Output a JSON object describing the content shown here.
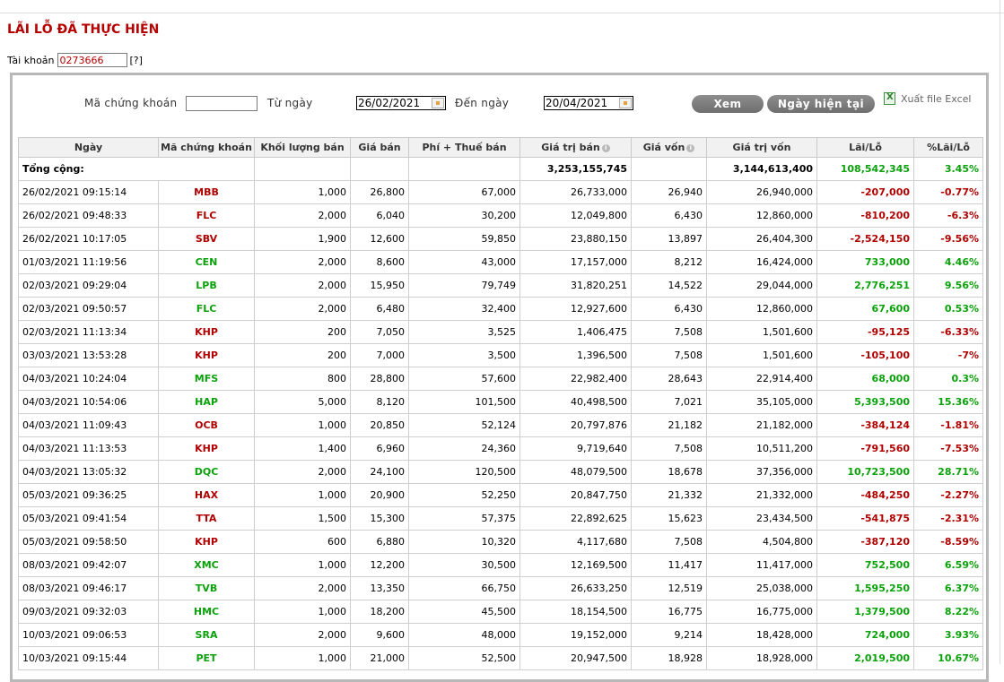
{
  "page": {
    "title": "LÃI LỖ ĐÃ THỰC HIỆN",
    "account_label": "Tài khoản",
    "account_value": "0273666",
    "help": "[?]"
  },
  "filters": {
    "symbol_label": "Mã chứng khoán",
    "symbol_value": "",
    "from_label": "Từ ngày",
    "from_value": "26/02/2021",
    "to_label": "Đến ngày",
    "to_value": "20/04/2021",
    "view_button": "Xem",
    "today_button": "Ngày hiện tại",
    "export_label": "Xuất file Excel"
  },
  "table": {
    "headers": [
      "Ngày",
      "Mã chứng khoán",
      "Khối lượng bán",
      "Giá bán",
      "Phí + Thuế bán",
      "Giá trị bán",
      "Giá vốn",
      "Giá trị vốn",
      "Lãi/Lỗ",
      "%Lãi/Lỗ"
    ],
    "total": {
      "label": "Tổng cộng:",
      "sell_value": "3,253,155,745",
      "cost_value": "3,144,613,400",
      "pl": "108,542,345",
      "pl_pct": "3.45%"
    },
    "rows": [
      {
        "date": "26/02/2021 09:15:14",
        "symbol": "MBB",
        "qty": "1,000",
        "price": "26,800",
        "fee": "67,000",
        "sell_value": "26,733,000",
        "cost": "26,940",
        "cost_value": "26,940,000",
        "pl": "-207,000",
        "pct": "-0.77%"
      },
      {
        "date": "26/02/2021 09:48:33",
        "symbol": "FLC",
        "qty": "2,000",
        "price": "6,040",
        "fee": "30,200",
        "sell_value": "12,049,800",
        "cost": "6,430",
        "cost_value": "12,860,000",
        "pl": "-810,200",
        "pct": "-6.3%"
      },
      {
        "date": "26/02/2021 10:17:05",
        "symbol": "SBV",
        "qty": "1,900",
        "price": "12,600",
        "fee": "59,850",
        "sell_value": "23,880,150",
        "cost": "13,897",
        "cost_value": "26,404,300",
        "pl": "-2,524,150",
        "pct": "-9.56%"
      },
      {
        "date": "01/03/2021 11:19:56",
        "symbol": "CEN",
        "qty": "2,000",
        "price": "8,600",
        "fee": "43,000",
        "sell_value": "17,157,000",
        "cost": "8,212",
        "cost_value": "16,424,000",
        "pl": "733,000",
        "pct": "4.46%"
      },
      {
        "date": "02/03/2021 09:29:04",
        "symbol": "LPB",
        "qty": "2,000",
        "price": "15,950",
        "fee": "79,749",
        "sell_value": "31,820,251",
        "cost": "14,522",
        "cost_value": "29,044,000",
        "pl": "2,776,251",
        "pct": "9.56%"
      },
      {
        "date": "02/03/2021 09:50:57",
        "symbol": "FLC",
        "qty": "2,000",
        "price": "6,480",
        "fee": "32,400",
        "sell_value": "12,927,600",
        "cost": "6,430",
        "cost_value": "12,860,000",
        "pl": "67,600",
        "pct": "0.53%"
      },
      {
        "date": "02/03/2021 11:13:34",
        "symbol": "KHP",
        "qty": "200",
        "price": "7,050",
        "fee": "3,525",
        "sell_value": "1,406,475",
        "cost": "7,508",
        "cost_value": "1,501,600",
        "pl": "-95,125",
        "pct": "-6.33%"
      },
      {
        "date": "03/03/2021 13:53:28",
        "symbol": "KHP",
        "qty": "200",
        "price": "7,000",
        "fee": "3,500",
        "sell_value": "1,396,500",
        "cost": "7,508",
        "cost_value": "1,501,600",
        "pl": "-105,100",
        "pct": "-7%"
      },
      {
        "date": "04/03/2021 10:24:04",
        "symbol": "MFS",
        "qty": "800",
        "price": "28,800",
        "fee": "57,600",
        "sell_value": "22,982,400",
        "cost": "28,643",
        "cost_value": "22,914,400",
        "pl": "68,000",
        "pct": "0.3%"
      },
      {
        "date": "04/03/2021 10:54:06",
        "symbol": "HAP",
        "qty": "5,000",
        "price": "8,120",
        "fee": "101,500",
        "sell_value": "40,498,500",
        "cost": "7,021",
        "cost_value": "35,105,000",
        "pl": "5,393,500",
        "pct": "15.36%"
      },
      {
        "date": "04/03/2021 11:09:43",
        "symbol": "OCB",
        "qty": "1,000",
        "price": "20,850",
        "fee": "52,124",
        "sell_value": "20,797,876",
        "cost": "21,182",
        "cost_value": "21,182,000",
        "pl": "-384,124",
        "pct": "-1.81%"
      },
      {
        "date": "04/03/2021 11:13:53",
        "symbol": "KHP",
        "qty": "1,400",
        "price": "6,960",
        "fee": "24,360",
        "sell_value": "9,719,640",
        "cost": "7,508",
        "cost_value": "10,511,200",
        "pl": "-791,560",
        "pct": "-7.53%"
      },
      {
        "date": "04/03/2021 13:05:32",
        "symbol": "DQC",
        "qty": "2,000",
        "price": "24,100",
        "fee": "120,500",
        "sell_value": "48,079,500",
        "cost": "18,678",
        "cost_value": "37,356,000",
        "pl": "10,723,500",
        "pct": "28.71%"
      },
      {
        "date": "05/03/2021 09:36:25",
        "symbol": "HAX",
        "qty": "1,000",
        "price": "20,900",
        "fee": "52,250",
        "sell_value": "20,847,750",
        "cost": "21,332",
        "cost_value": "21,332,000",
        "pl": "-484,250",
        "pct": "-2.27%"
      },
      {
        "date": "05/03/2021 09:41:54",
        "symbol": "TTA",
        "qty": "1,500",
        "price": "15,300",
        "fee": "57,375",
        "sell_value": "22,892,625",
        "cost": "15,623",
        "cost_value": "23,434,500",
        "pl": "-541,875",
        "pct": "-2.31%"
      },
      {
        "date": "05/03/2021 09:58:50",
        "symbol": "KHP",
        "qty": "600",
        "price": "6,880",
        "fee": "10,320",
        "sell_value": "4,117,680",
        "cost": "7,508",
        "cost_value": "4,504,800",
        "pl": "-387,120",
        "pct": "-8.59%"
      },
      {
        "date": "08/03/2021 09:42:07",
        "symbol": "XMC",
        "qty": "1,000",
        "price": "12,200",
        "fee": "30,500",
        "sell_value": "12,169,500",
        "cost": "11,417",
        "cost_value": "11,417,000",
        "pl": "752,500",
        "pct": "6.59%"
      },
      {
        "date": "08/03/2021 09:46:17",
        "symbol": "TVB",
        "qty": "2,000",
        "price": "13,350",
        "fee": "66,750",
        "sell_value": "26,633,250",
        "cost": "12,519",
        "cost_value": "25,038,000",
        "pl": "1,595,250",
        "pct": "6.37%"
      },
      {
        "date": "09/03/2021 09:32:03",
        "symbol": "HMC",
        "qty": "1,000",
        "price": "18,200",
        "fee": "45,500",
        "sell_value": "18,154,500",
        "cost": "16,775",
        "cost_value": "16,775,000",
        "pl": "1,379,500",
        "pct": "8.22%"
      },
      {
        "date": "10/03/2021 09:06:53",
        "symbol": "SRA",
        "qty": "2,000",
        "price": "9,600",
        "fee": "48,000",
        "sell_value": "19,152,000",
        "cost": "9,214",
        "cost_value": "18,428,000",
        "pl": "724,000",
        "pct": "3.93%"
      },
      {
        "date": "10/03/2021 09:15:44",
        "symbol": "PET",
        "qty": "1,000",
        "price": "21,000",
        "fee": "52,500",
        "sell_value": "20,947,500",
        "cost": "18,928",
        "cost_value": "18,928,000",
        "pl": "2,019,500",
        "pct": "10.67%"
      }
    ]
  },
  "colors": {
    "title_red": "#b50000",
    "profit_green": "#0aa20a",
    "loss_red": "#b00000",
    "button_gray": "#7e7e7e",
    "panel_border": "#b8b8b8"
  },
  "icons": {
    "calendar": "calendar-icon",
    "info": "info-icon",
    "excel": "excel-icon"
  }
}
